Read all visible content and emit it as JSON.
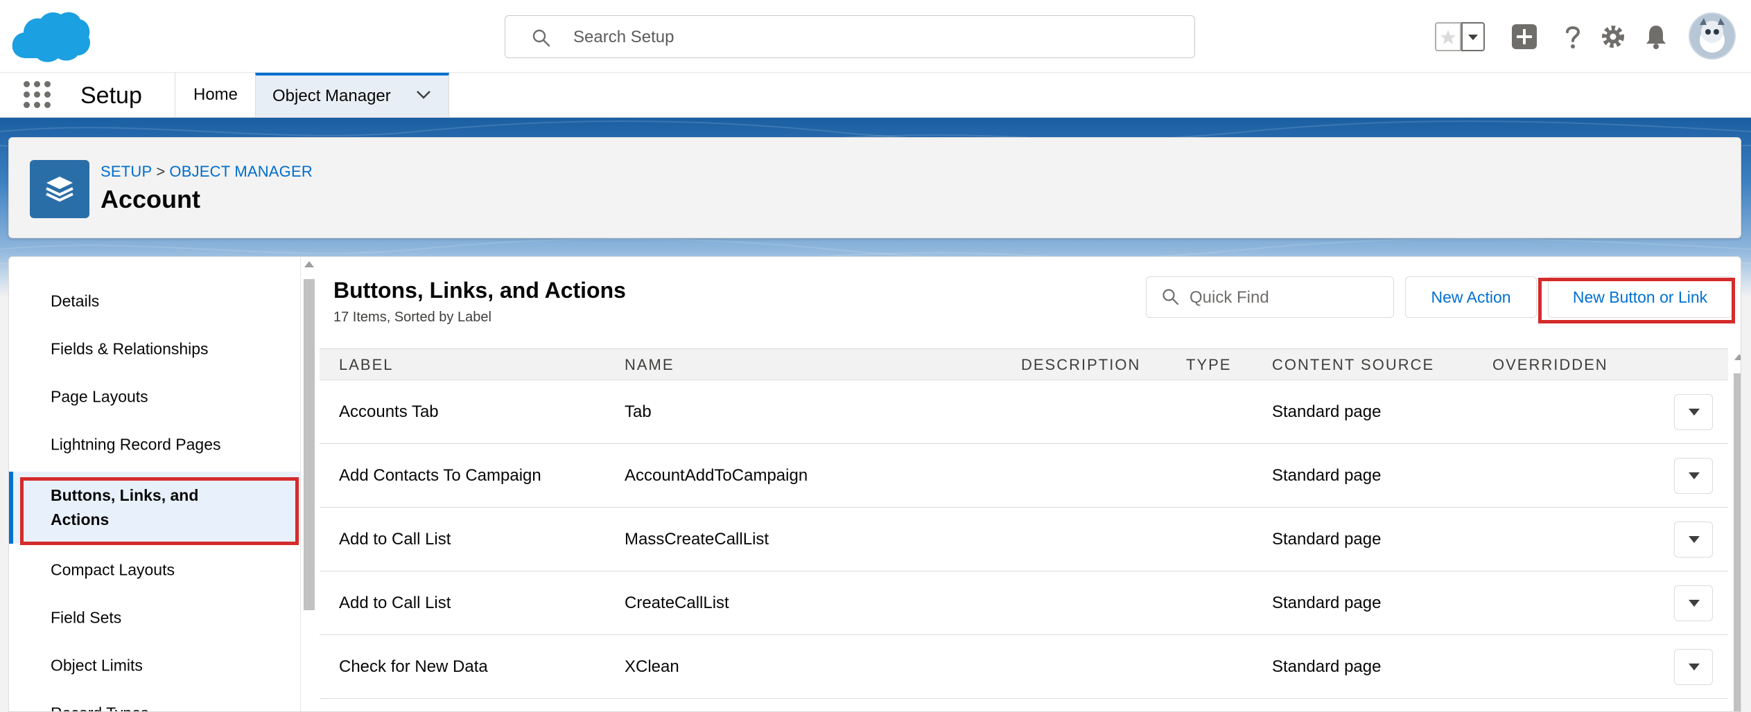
{
  "header": {
    "search_placeholder": "Search Setup",
    "icons": [
      "salesforce-cloud-logo",
      "search-icon",
      "star-icon",
      "chevron-down-icon",
      "add-icon",
      "help-icon",
      "gear-icon",
      "bell-icon",
      "avatar"
    ]
  },
  "nav": {
    "app_name": "Setup",
    "tabs": [
      {
        "label": "Home"
      },
      {
        "label": "Object Manager",
        "active": true
      }
    ]
  },
  "page_header": {
    "breadcrumb": [
      "SETUP",
      ">",
      "OBJECT MANAGER"
    ],
    "title": "Account"
  },
  "sidebar": {
    "items": [
      {
        "label": "Details"
      },
      {
        "label": "Fields & Relationships"
      },
      {
        "label": "Page Layouts"
      },
      {
        "label": "Lightning Record Pages"
      },
      {
        "label": "Buttons, Links, and Actions",
        "active": true
      },
      {
        "label": "Compact Layouts"
      },
      {
        "label": "Field Sets"
      },
      {
        "label": "Object Limits"
      },
      {
        "label": "Record Types"
      }
    ]
  },
  "main": {
    "title": "Buttons, Links, and Actions",
    "subtitle": "17 Items, Sorted by Label",
    "quick_find_placeholder": "Quick Find",
    "new_action_label": "New Action",
    "new_button_label": "New Button or Link",
    "columns": [
      "LABEL",
      "NAME",
      "DESCRIPTION",
      "TYPE",
      "CONTENT SOURCE",
      "OVERRIDDEN"
    ],
    "rows": [
      {
        "label": "Accounts Tab",
        "name": "Tab",
        "description": "",
        "type": "",
        "content_source": "Standard page",
        "overridden": ""
      },
      {
        "label": "Add Contacts To Campaign",
        "name": "AccountAddToCampaign",
        "description": "",
        "type": "",
        "content_source": "Standard page",
        "overridden": ""
      },
      {
        "label": "Add to Call List",
        "name": "MassCreateCallList",
        "description": "",
        "type": "",
        "content_source": "Standard page",
        "overridden": ""
      },
      {
        "label": "Add to Call List",
        "name": "CreateCallList",
        "description": "",
        "type": "",
        "content_source": "Standard page",
        "overridden": ""
      },
      {
        "label": "Check for New Data",
        "name": "XClean",
        "description": "",
        "type": "",
        "content_source": "Standard page",
        "overridden": ""
      }
    ]
  },
  "colors": {
    "brand_blue": "#0070d2",
    "highlight_red": "#d42b2b",
    "object_icon": "#2a6ea8"
  }
}
